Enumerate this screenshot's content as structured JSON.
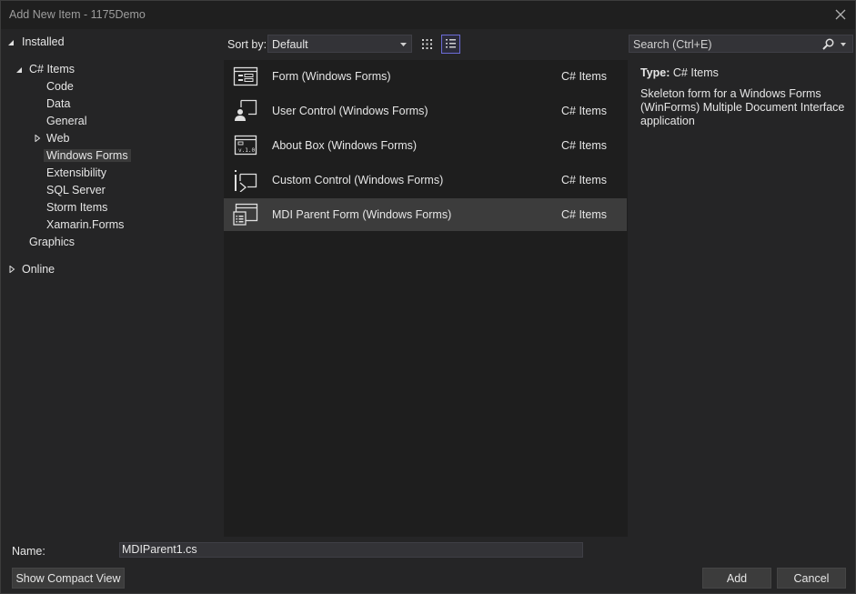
{
  "window": {
    "title": "Add New Item - 1175Demo"
  },
  "tree": {
    "installed": "Installed",
    "csharp_items": "C# Items",
    "children": [
      "Code",
      "Data",
      "General",
      "Web",
      "Windows Forms",
      "Extensibility",
      "SQL Server",
      "Storm Items",
      "Xamarin.Forms"
    ],
    "selected": "Windows Forms",
    "graphics": "Graphics",
    "online": "Online"
  },
  "toolbar": {
    "sort_label": "Sort by:",
    "sort_value": "Default"
  },
  "items": [
    {
      "name": "Form (Windows Forms)",
      "category": "C# Items",
      "icon": "form-icon"
    },
    {
      "name": "User Control (Windows Forms)",
      "category": "C# Items",
      "icon": "user-control-icon"
    },
    {
      "name": "About Box (Windows Forms)",
      "category": "C# Items",
      "icon": "about-box-icon"
    },
    {
      "name": "Custom Control (Windows Forms)",
      "category": "C# Items",
      "icon": "custom-control-icon"
    },
    {
      "name": "MDI Parent Form (Windows Forms)",
      "category": "C# Items",
      "icon": "mdi-parent-form-icon"
    }
  ],
  "selected_item": "MDI Parent Form (Windows Forms)",
  "search": {
    "placeholder": "Search (Ctrl+E)"
  },
  "details": {
    "type_label": "Type:",
    "type_value": "C# Items",
    "description": "Skeleton form for a Windows Forms (WinForms) Multiple Document Interface application"
  },
  "footer": {
    "name_label": "Name:",
    "name_value": "MDIParent1.cs",
    "compact_view": "Show Compact View",
    "add": "Add",
    "cancel": "Cancel"
  },
  "colors": {
    "accent": "#6b6bd6",
    "selected_row": "#3c3c3c",
    "background": "#1f1f1f"
  }
}
